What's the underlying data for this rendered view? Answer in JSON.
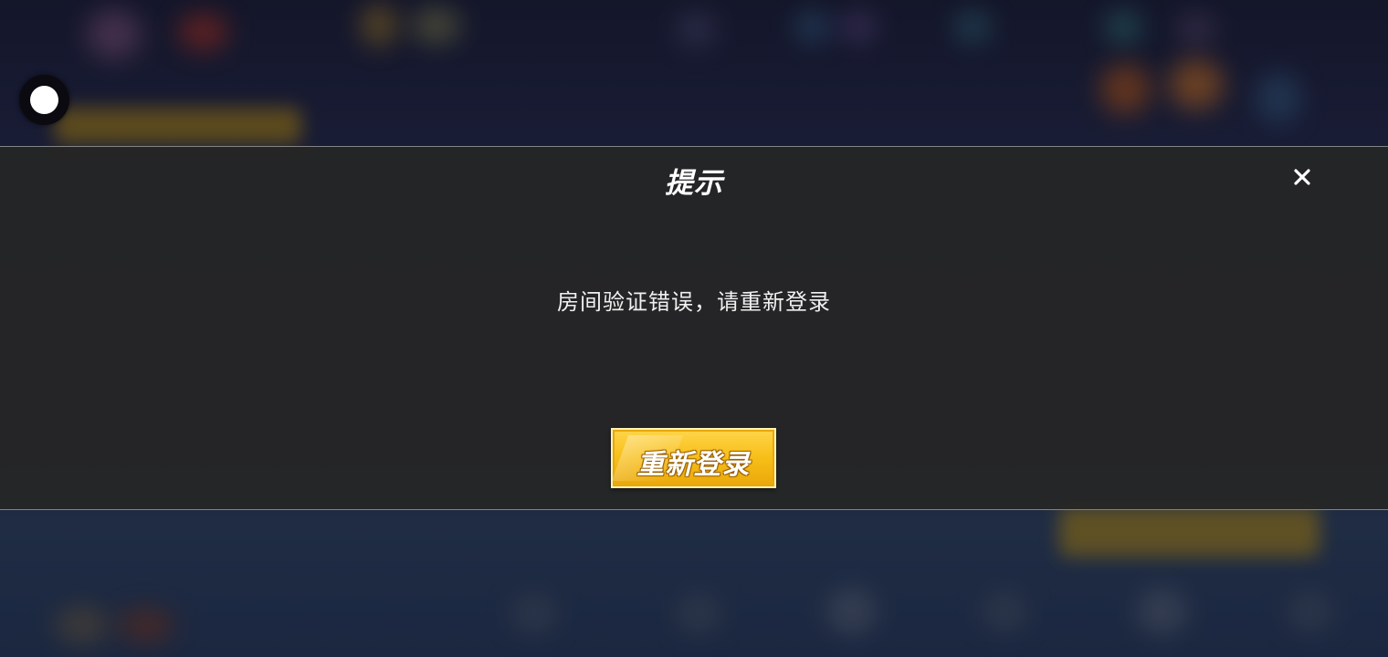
{
  "dialog": {
    "title": "提示",
    "message": "房间验证错误，请重新登录",
    "close_icon": "close-icon",
    "relogin_label": "重新登录"
  },
  "floating_button": {
    "icon": "assistive-touch-icon"
  },
  "colors": {
    "button_gold": "#f7be18",
    "dialog_bg": "#262626",
    "text": "#ffffff"
  }
}
